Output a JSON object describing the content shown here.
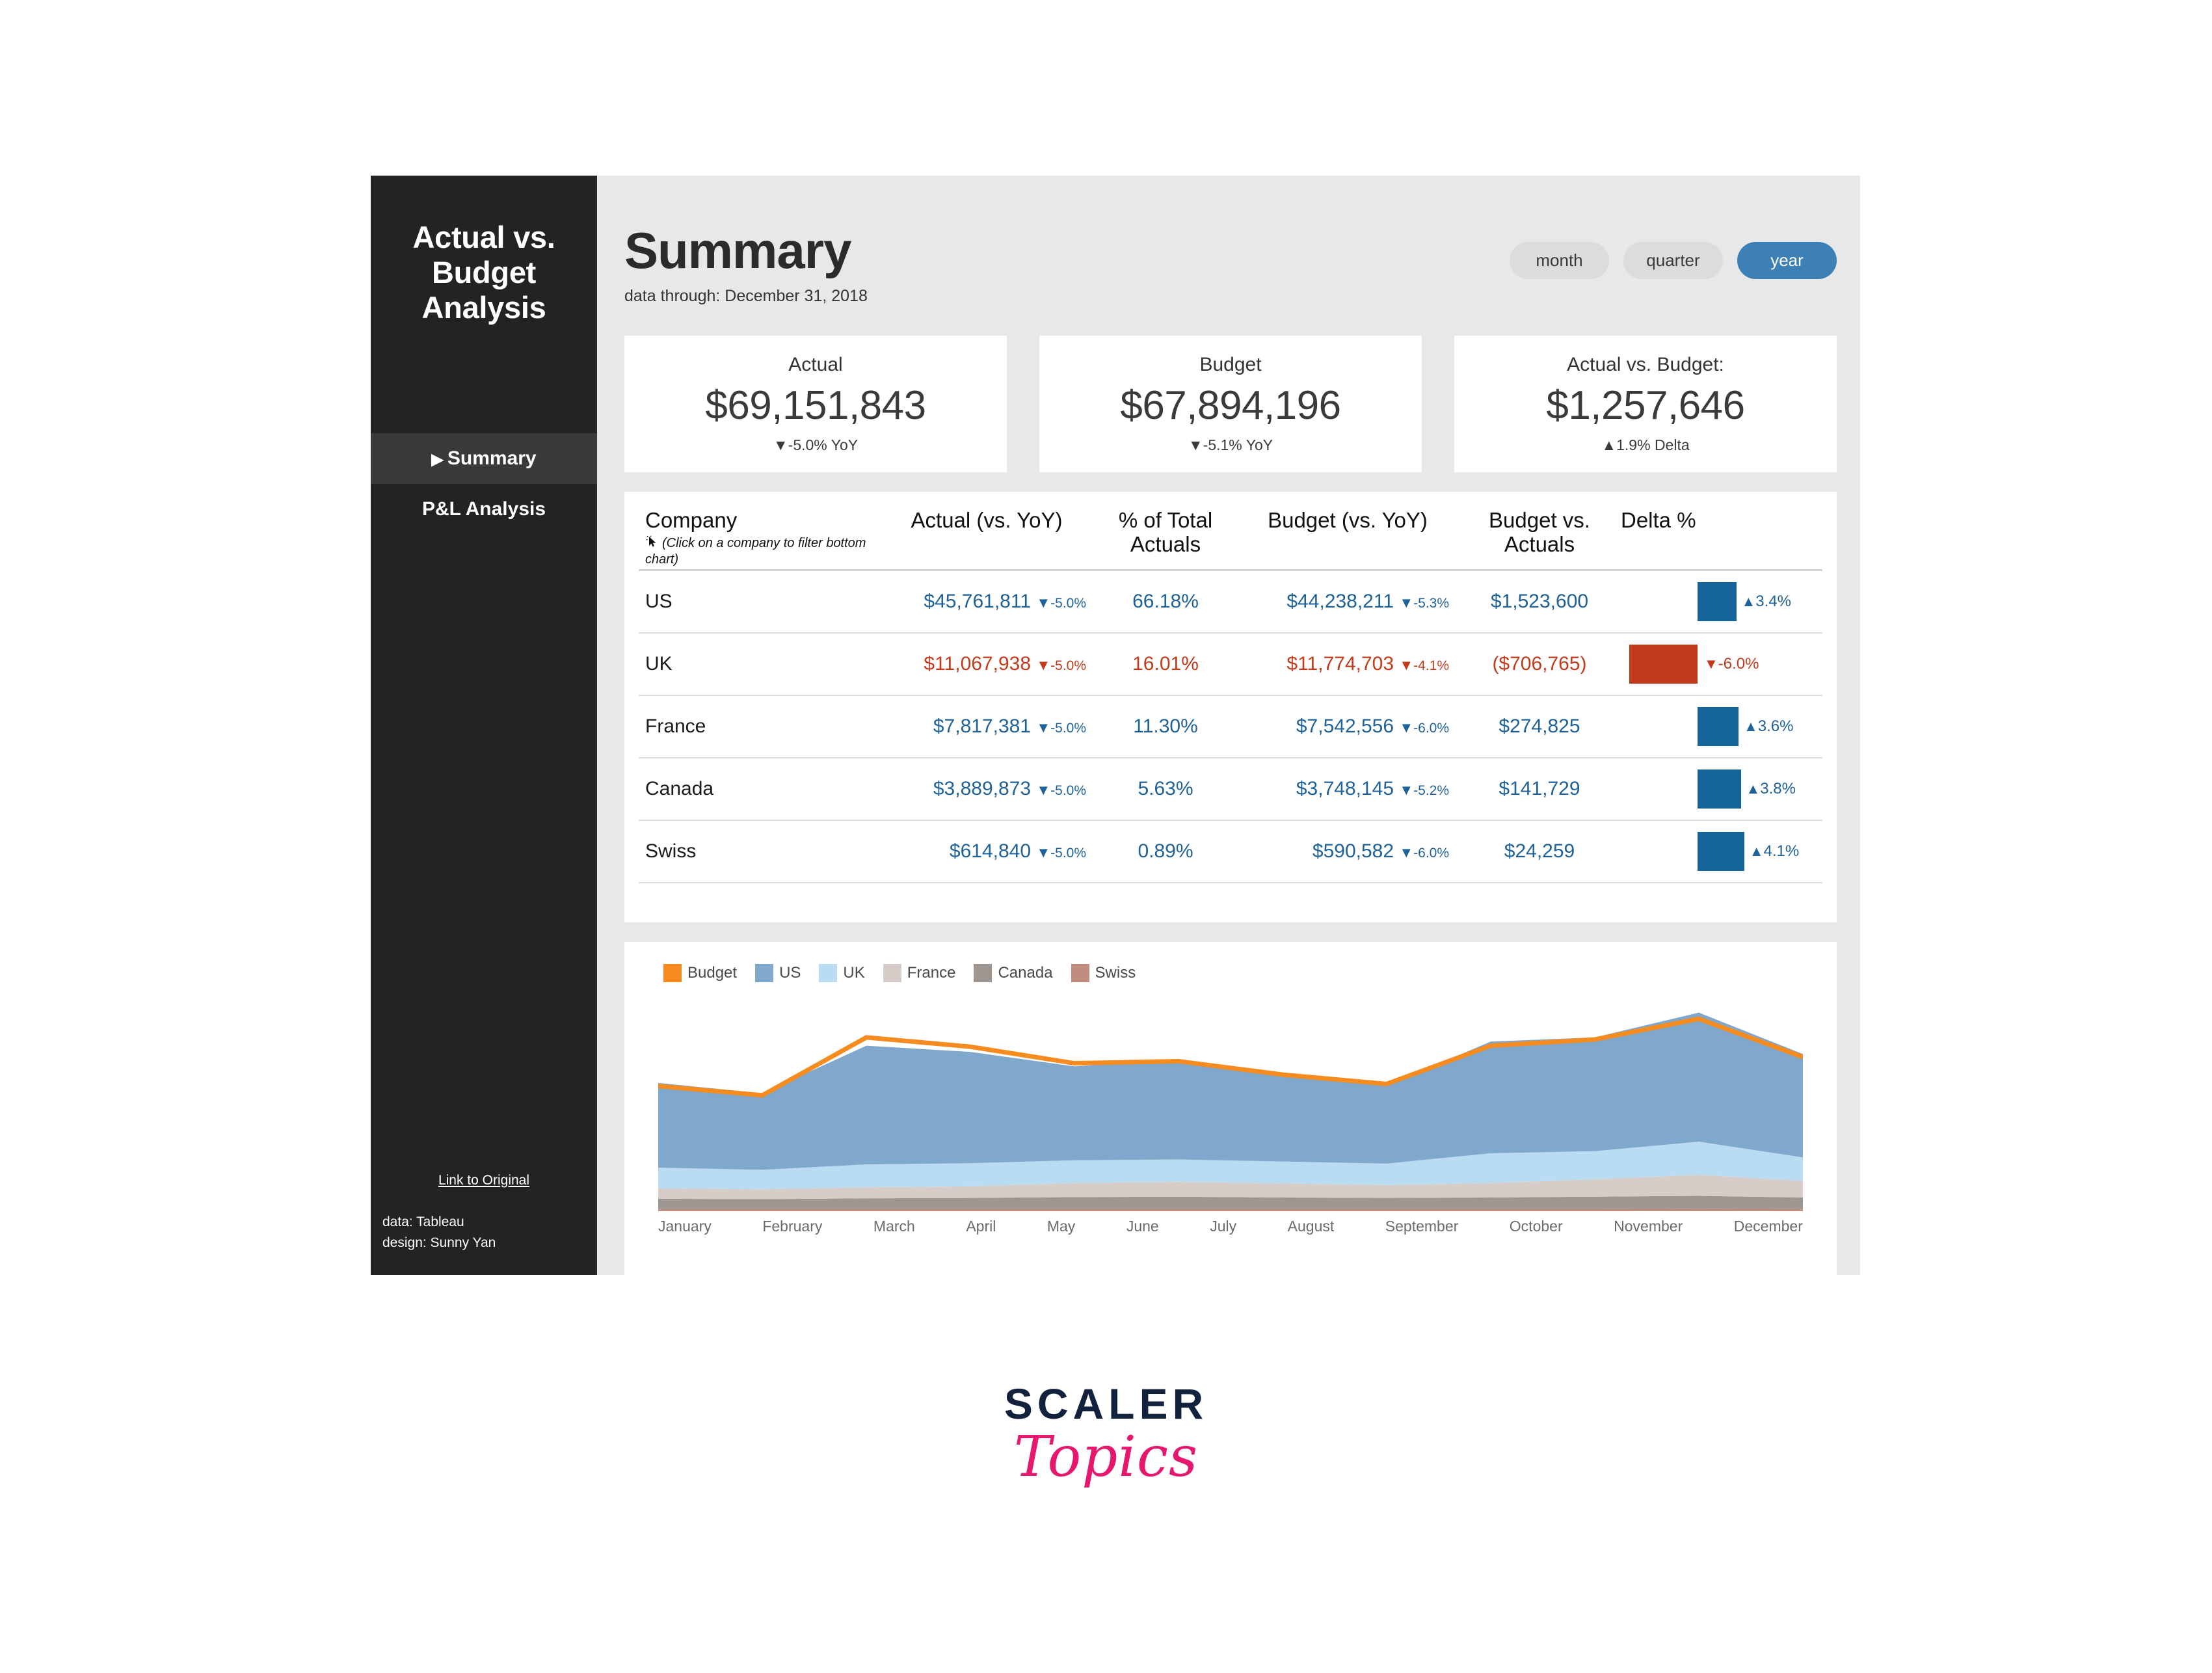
{
  "sidebar": {
    "title": "Actual vs. Budget Analysis",
    "nav": [
      {
        "label": "Summary",
        "caret": "▶",
        "active": true
      },
      {
        "label": "P&L Analysis",
        "caret": "",
        "active": false
      }
    ],
    "link_label": "Link to Original",
    "credit_data": "data: Tableau",
    "credit_design": "design: Sunny Yan"
  },
  "header": {
    "title": "Summary",
    "subtitle": "data through: December 31, 2018",
    "pills": [
      {
        "label": "month",
        "active": false
      },
      {
        "label": "quarter",
        "active": false
      },
      {
        "label": "year",
        "active": true
      }
    ]
  },
  "kpis": [
    {
      "label": "Actual",
      "value": "$69,151,843",
      "arrow": "▼",
      "delta": "-5.0% YoY"
    },
    {
      "label": "Budget",
      "value": "$67,894,196",
      "arrow": "▼",
      "delta": "-5.1% YoY"
    },
    {
      "label": "Actual vs. Budget:",
      "value": "$1,257,646",
      "arrow": "▲",
      "delta": "1.9% Delta"
    }
  ],
  "table": {
    "headers": {
      "company": "Company",
      "company_hint": "(Click on a company to filter bottom chart)",
      "actual": "Actual (vs. YoY)",
      "pct_of_total": "% of Total Actuals",
      "budget": "Budget (vs. YoY)",
      "budget_vs_actuals": "Budget vs. Actuals",
      "delta_pct": "Delta %"
    },
    "rows": [
      {
        "company": "US",
        "actual": "$45,761,811",
        "actual_arrow": "▼",
        "actual_yoy": "-5.0%",
        "pct": "66.18%",
        "budget": "$44,238,211",
        "budget_arrow": "▼",
        "budget_yoy": "-5.3%",
        "bva": "$1,523,600",
        "delta_arrow": "▲",
        "delta": "3.4%",
        "delta_value": 3.4,
        "negative": false
      },
      {
        "company": "UK",
        "actual": "$11,067,938",
        "actual_arrow": "▼",
        "actual_yoy": "-5.0%",
        "pct": "16.01%",
        "budget": "$11,774,703",
        "budget_arrow": "▼",
        "budget_yoy": "-4.1%",
        "bva": "($706,765)",
        "delta_arrow": "▼",
        "delta": "-6.0%",
        "delta_value": -6.0,
        "negative": true
      },
      {
        "company": "France",
        "actual": "$7,817,381",
        "actual_arrow": "▼",
        "actual_yoy": "-5.0%",
        "pct": "11.30%",
        "budget": "$7,542,556",
        "budget_arrow": "▼",
        "budget_yoy": "-6.0%",
        "bva": "$274,825",
        "delta_arrow": "▲",
        "delta": "3.6%",
        "delta_value": 3.6,
        "negative": false
      },
      {
        "company": "Canada",
        "actual": "$3,889,873",
        "actual_arrow": "▼",
        "actual_yoy": "-5.0%",
        "pct": "5.63%",
        "budget": "$3,748,145",
        "budget_arrow": "▼",
        "budget_yoy": "-5.2%",
        "bva": "$141,729",
        "delta_arrow": "▲",
        "delta": "3.8%",
        "delta_value": 3.8,
        "negative": false
      },
      {
        "company": "Swiss",
        "actual": "$614,840",
        "actual_arrow": "▼",
        "actual_yoy": "-5.0%",
        "pct": "0.89%",
        "budget": "$590,582",
        "budget_arrow": "▼",
        "budget_yoy": "-6.0%",
        "bva": "$24,259",
        "delta_arrow": "▲",
        "delta": "4.1%",
        "delta_value": 4.1,
        "negative": false
      }
    ]
  },
  "colors": {
    "positive": "#156497",
    "negative": "#c03a1b",
    "accent_blue": "#3d80b5",
    "budget_line": "#f68b1f",
    "sidebar_bg": "#232323",
    "canvas_bg": "#e8e8e8"
  },
  "chart_data": {
    "type": "area",
    "title": "",
    "xlabel": "",
    "ylabel": "",
    "grid": false,
    "legend_position": "top-left",
    "categories": [
      "January",
      "February",
      "March",
      "April",
      "May",
      "June",
      "July",
      "August",
      "September",
      "October",
      "November",
      "December"
    ],
    "legend": [
      "Budget",
      "US",
      "UK",
      "France",
      "Canada",
      "Swiss"
    ],
    "series_colors": {
      "Budget": "#f68b1f",
      "US": "#7fa8cc",
      "UK": "#b9dcf2",
      "France": "#d6cdc9",
      "Canada": "#9e9690",
      "Swiss": "#c08d7e"
    },
    "ylim": [
      0,
      100
    ],
    "series": [
      {
        "name": "Swiss",
        "values": [
          1.0,
          1.0,
          1.0,
          1.0,
          1.0,
          1.0,
          1.0,
          1.0,
          1.0,
          1.0,
          1.2,
          1.0
        ]
      },
      {
        "name": "Canada",
        "values": [
          6.0,
          5.8,
          6.2,
          6.4,
          6.8,
          7.0,
          6.6,
          6.4,
          6.6,
          7.0,
          7.4,
          6.6
        ]
      },
      {
        "name": "France",
        "values": [
          11.0,
          10.6,
          11.6,
          12.0,
          13.6,
          14.2,
          13.4,
          12.6,
          13.6,
          15.4,
          17.6,
          14.6
        ]
      },
      {
        "name": "UK",
        "values": [
          21.0,
          20.0,
          22.6,
          23.2,
          24.6,
          25.0,
          24.0,
          23.0,
          28.0,
          29.0,
          33.6,
          26.0
        ]
      },
      {
        "name": "US",
        "values": [
          62.0,
          57.0,
          80.0,
          77.0,
          70.0,
          73.0,
          67.0,
          60.5,
          82.0,
          84.0,
          96.0,
          76.0
        ]
      },
      {
        "name": "Budget",
        "values": [
          60.5,
          56.0,
          84.0,
          79.5,
          71.5,
          72.5,
          66.0,
          61.5,
          80.0,
          83.0,
          93.0,
          74.5
        ]
      }
    ]
  },
  "logo": {
    "scaler": "SCALER",
    "topics": "Topics"
  }
}
